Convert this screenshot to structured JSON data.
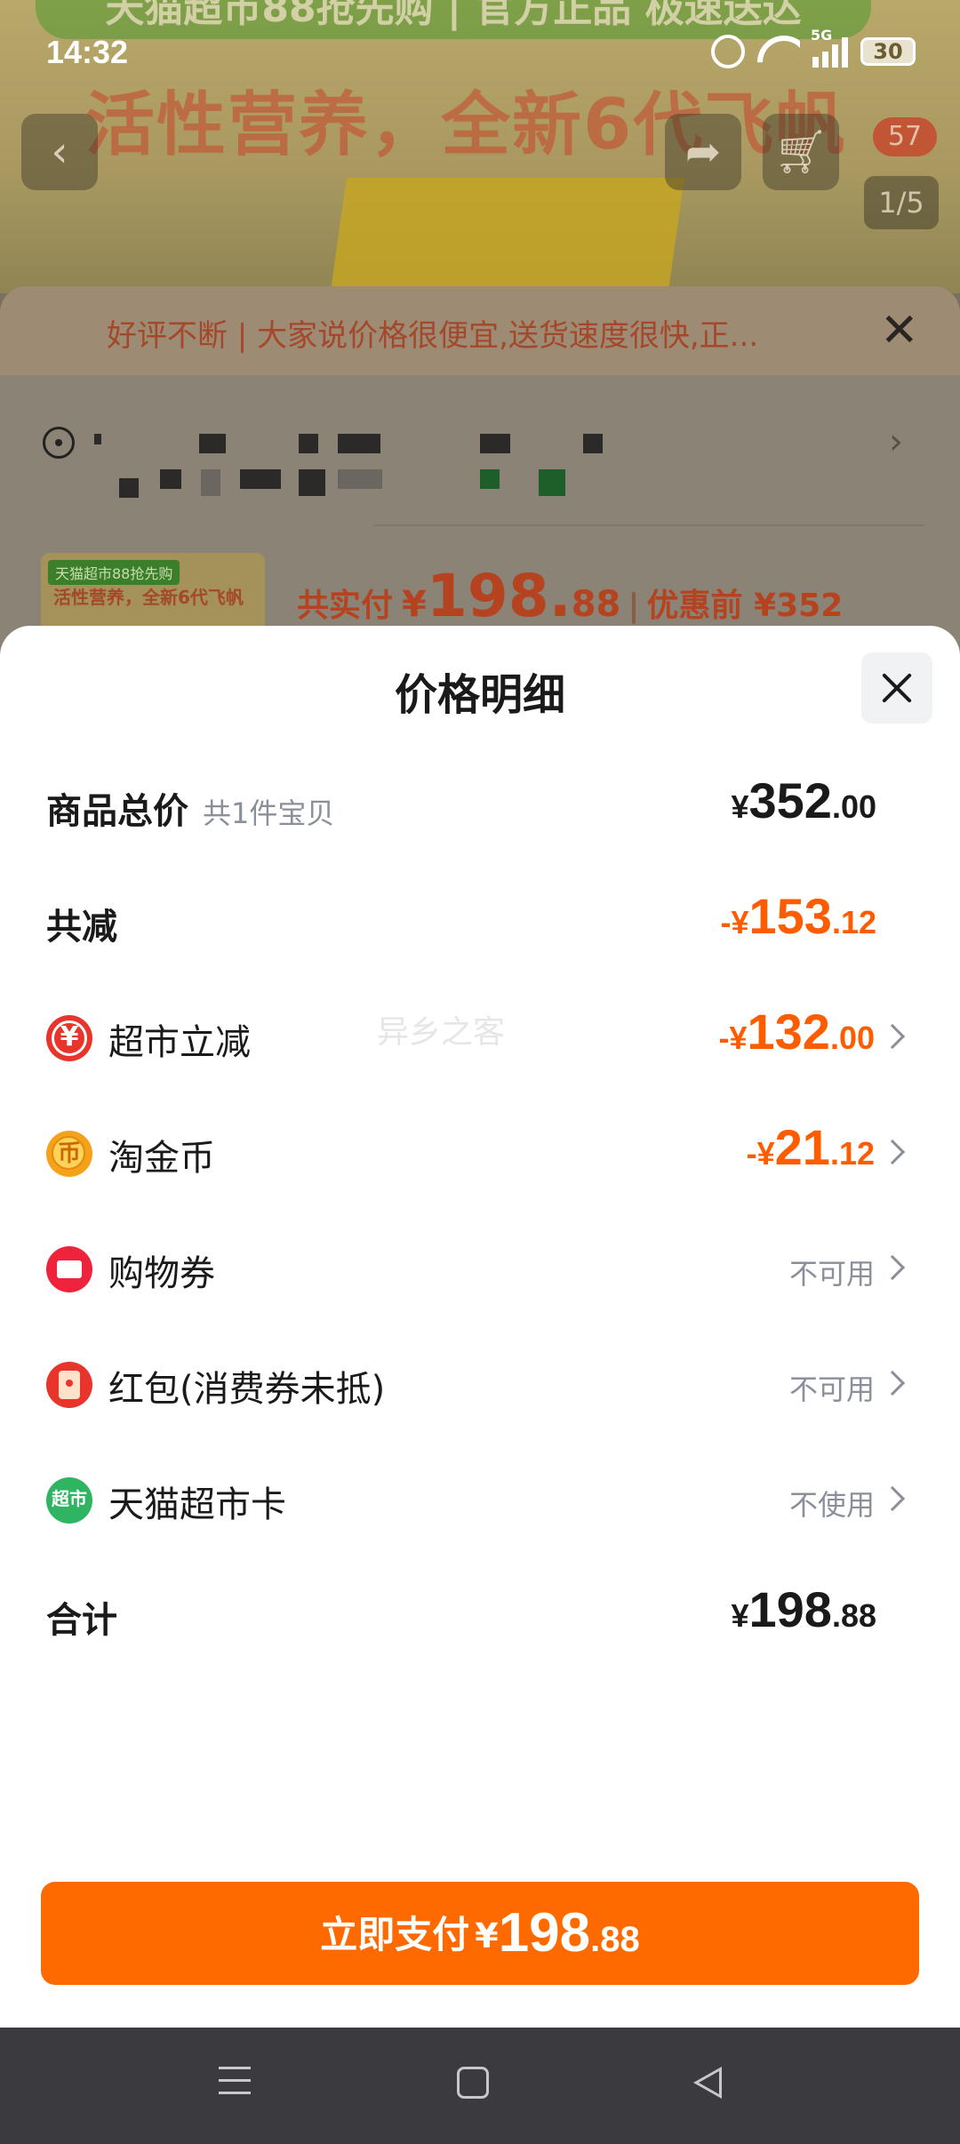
{
  "status_bar": {
    "time": "14:32",
    "network": "5G",
    "battery": "30"
  },
  "background": {
    "banner": "天猫超市88抢先购 | 官方正品 极速送达",
    "headline": "活性营养，全新6代飞帆",
    "cart_badge": "57",
    "pager": "1/5",
    "review_text": "好评不断 | 大家说价格很便宜,送货速度很快,正...",
    "thumb_tag": "天猫超市88抢先购",
    "thumb_title": "活性营养，全新6代飞帆",
    "pay_label": "共实付",
    "pay_currency": "¥",
    "pay_int": "198.",
    "pay_dec": "88",
    "before_label": "优惠前 ¥352"
  },
  "sheet": {
    "title": "价格明细",
    "rows": [
      {
        "label": "商品总价",
        "sub": "共1件宝贝",
        "cur": "¥",
        "int": "352",
        "dec": ".00"
      },
      {
        "label": "共减",
        "cur": "-¥",
        "int": "153",
        "dec": ".12"
      },
      {
        "label": "超市立减",
        "icon": "supermarket-discount-icon",
        "cur": "-¥",
        "int": "132",
        "dec": ".00"
      },
      {
        "label": "淘金币",
        "icon": "taojinbi-coin-icon",
        "cur": "-¥",
        "int": "21",
        "dec": ".12"
      },
      {
        "label": "购物券",
        "icon": "shopping-coupon-icon",
        "status": "不可用"
      },
      {
        "label": "红包(消费券未抵)",
        "icon": "red-packet-icon",
        "status": "不可用"
      },
      {
        "label": "天猫超市卡",
        "icon": "tmall-supermarket-card-icon",
        "status": "不使用"
      },
      {
        "label": "合计",
        "cur": "¥",
        "int": "198",
        "dec": ".88"
      }
    ],
    "watermark": "异乡之客",
    "pay_button": {
      "label": "立即支付",
      "cur": "¥",
      "int": "198",
      "dec": ".88"
    }
  },
  "colors": {
    "accent": "#ff6a00",
    "discount": "#ff5c00",
    "muted": "#8a8f99"
  }
}
